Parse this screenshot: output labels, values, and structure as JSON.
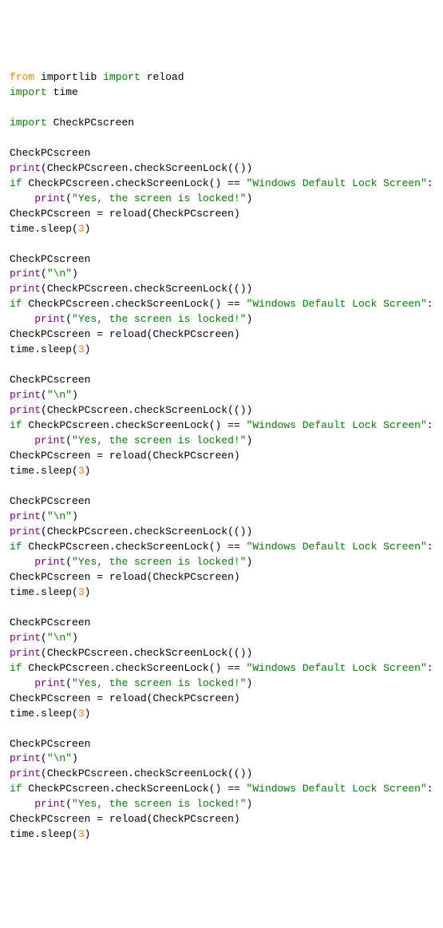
{
  "tokens": {
    "from": "from",
    "import": "import",
    "importlib": "importlib",
    "reload": "reload",
    "time": "time",
    "CheckPCscreen": "CheckPCscreen",
    "print": "print",
    "if": "if",
    "dot": ".",
    "checkScreenLock": "checkScreenLock",
    "open_paren": "(",
    "close_paren": ")",
    "double_paren_close": "())",
    "eq": "==",
    "colon": ":",
    "str_lock": "\"Windows Default Lock Screen\"",
    "str_yes": "\"Yes, the screen is locked!\"",
    "str_nl": "\"\\n\"",
    "assign": "=",
    "sleep": "sleep",
    "num3": "3",
    "indent": "    "
  }
}
